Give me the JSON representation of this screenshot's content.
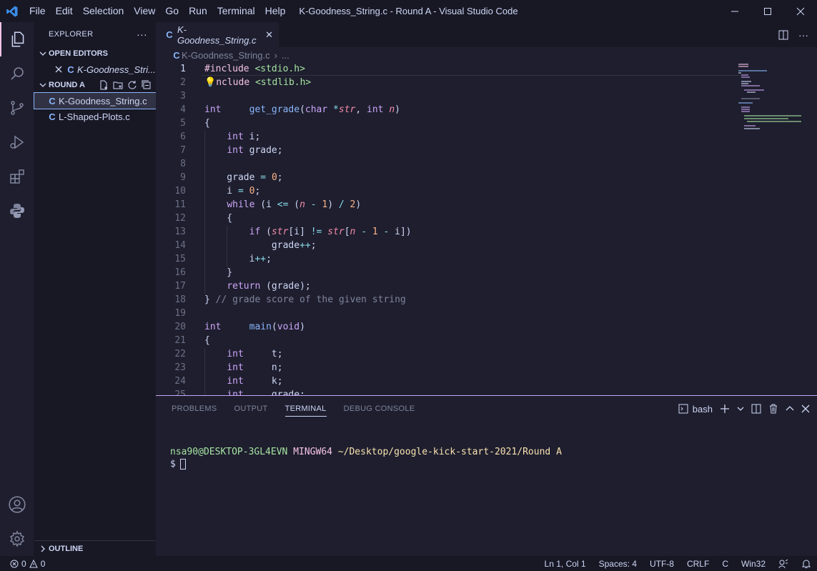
{
  "window": {
    "title": "K-Goodness_String.c - Round A - Visual Studio Code",
    "menu": [
      "File",
      "Edit",
      "Selection",
      "View",
      "Go",
      "Run",
      "Terminal",
      "Help"
    ]
  },
  "colors": {
    "accent": "#f5c2e7",
    "keyword": "#cba6f7",
    "function": "#89b4fa",
    "string": "#a6e3a1",
    "number": "#fab387",
    "comment": "#7f849c"
  },
  "activity": [
    "explorer-icon",
    "search-icon",
    "source-control-icon",
    "run-debug-icon",
    "extensions-icon",
    "python-icon",
    "account-icon",
    "settings-gear-icon"
  ],
  "sidebar": {
    "title": "EXPLORER",
    "more": "···",
    "open_editors_label": "OPEN EDITORS",
    "open_editor_file": "K-Goodness_Stri...",
    "folder_label": "ROUND A",
    "files": [
      "K-Goodness_String.c",
      "L-Shaped-Plots.c"
    ],
    "outline_label": "OUTLINE",
    "c_glyph": "C"
  },
  "tab": {
    "label": "K-Goodness_String.c",
    "close": "✕"
  },
  "breadcrumb": {
    "file": "K-Goodness_String.c",
    "more": "..."
  },
  "editor": {
    "line_numbers": [
      "1",
      "2",
      "3",
      "4",
      "5",
      "6",
      "7",
      "8",
      "9",
      "10",
      "11",
      "12",
      "13",
      "14",
      "15",
      "16",
      "17",
      "18",
      "19",
      "20",
      "21",
      "22",
      "23",
      "24",
      "25"
    ]
  },
  "panel": {
    "tabs": [
      "PROBLEMS",
      "OUTPUT",
      "TERMINAL",
      "DEBUG CONSOLE"
    ],
    "shell": "bash",
    "terminal_user": "nsa90@DESKTOP-3GL4EVN",
    "terminal_host": "MINGW64",
    "terminal_path": "~/Desktop/google-kick-start-2021/Round A",
    "prompt": "$"
  },
  "status": {
    "errors": "0",
    "warnings": "0",
    "position": "Ln 1, Col 1",
    "spaces": "Spaces: 4",
    "encoding": "UTF-8",
    "eol": "CRLF",
    "language": "C",
    "platform": "Win32"
  }
}
